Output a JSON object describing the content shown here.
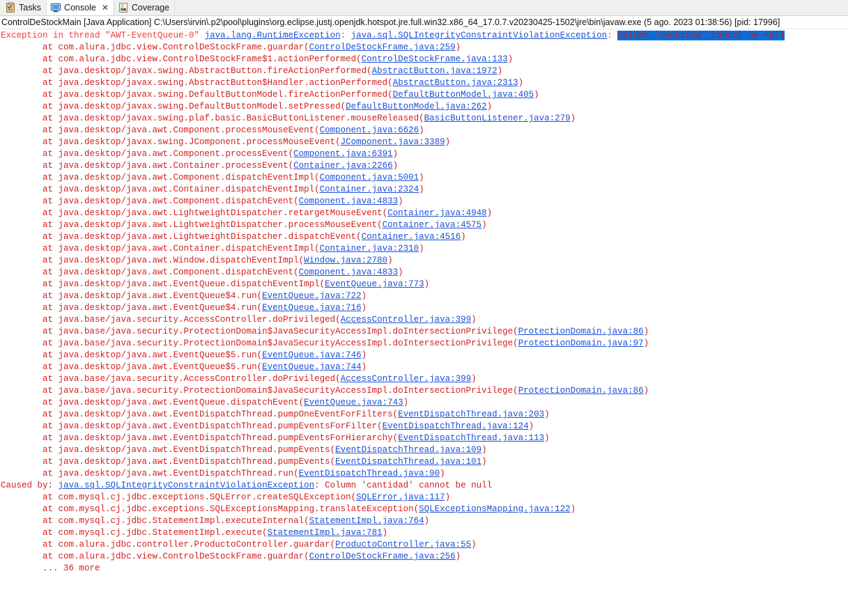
{
  "window": {
    "title": "Eclipse Console"
  },
  "tabs": [
    {
      "label": "Tasks",
      "icon": "tasks-icon",
      "active": false,
      "closable": false
    },
    {
      "label": "Console",
      "icon": "console-icon",
      "active": true,
      "closable": true,
      "close_glyph": "✕"
    },
    {
      "label": "Coverage",
      "icon": "coverage-icon",
      "active": false,
      "closable": false
    }
  ],
  "process_header": "ControlDeStockMain [Java Application] C:\\Users\\irvin\\.p2\\pool\\plugins\\org.eclipse.justj.openjdk.hotspot.jre.full.win32.x86_64_17.0.7.v20230425-1502\\jre\\bin\\javaw.exe  (5 ago. 2023 01:38:56) [pid: 17996]",
  "colors": {
    "error_red": "#ef3e36",
    "stderr_red": "#d32020",
    "hyperlink_blue": "#1a4fd6",
    "selection_blue": "#0a6ed8",
    "tab_bar_bg": "#f0f0f0",
    "console_bg": "#ffffff"
  },
  "selection": {
    "text": "Column 'cantidad' cannot be null"
  },
  "console_lines": [
    {
      "indent": 0,
      "parts": [
        {
          "t": "Exception in thread \"AWT-EventQueue-0\" ",
          "s": "err"
        },
        {
          "t": "java.lang.RuntimeException",
          "s": "link"
        },
        {
          "t": ": ",
          "s": "err"
        },
        {
          "t": "java.sql.SQLIntegrityConstraintViolationException",
          "s": "link"
        },
        {
          "t": ": ",
          "s": "err"
        },
        {
          "t": "Column 'cantidad' cannot be null",
          "s": "sel"
        }
      ]
    },
    {
      "indent": 8,
      "parts": [
        {
          "t": "at com.alura.jdbc.view.ControlDeStockFrame.guardar(",
          "s": "sev"
        },
        {
          "t": "ControlDeStockFrame.java:259",
          "s": "link"
        },
        {
          "t": ")",
          "s": "sev"
        }
      ]
    },
    {
      "indent": 8,
      "parts": [
        {
          "t": "at com.alura.jdbc.view.ControlDeStockFrame$1.actionPerformed(",
          "s": "sev"
        },
        {
          "t": "ControlDeStockFrame.java:133",
          "s": "link"
        },
        {
          "t": ")",
          "s": "sev"
        }
      ]
    },
    {
      "indent": 8,
      "parts": [
        {
          "t": "at java.desktop/javax.swing.AbstractButton.fireActionPerformed(",
          "s": "sev"
        },
        {
          "t": "AbstractButton.java:1972",
          "s": "link"
        },
        {
          "t": ")",
          "s": "sev"
        }
      ]
    },
    {
      "indent": 8,
      "parts": [
        {
          "t": "at java.desktop/javax.swing.AbstractButton$Handler.actionPerformed(",
          "s": "sev"
        },
        {
          "t": "AbstractButton.java:2313",
          "s": "link"
        },
        {
          "t": ")",
          "s": "sev"
        }
      ]
    },
    {
      "indent": 8,
      "parts": [
        {
          "t": "at java.desktop/javax.swing.DefaultButtonModel.fireActionPerformed(",
          "s": "sev"
        },
        {
          "t": "DefaultButtonModel.java:405",
          "s": "link"
        },
        {
          "t": ")",
          "s": "sev"
        }
      ]
    },
    {
      "indent": 8,
      "parts": [
        {
          "t": "at java.desktop/javax.swing.DefaultButtonModel.setPressed(",
          "s": "sev"
        },
        {
          "t": "DefaultButtonModel.java:262",
          "s": "link"
        },
        {
          "t": ")",
          "s": "sev"
        }
      ]
    },
    {
      "indent": 8,
      "parts": [
        {
          "t": "at java.desktop/javax.swing.plaf.basic.BasicButtonListener.mouseReleased(",
          "s": "sev"
        },
        {
          "t": "BasicButtonListener.java:279",
          "s": "link"
        },
        {
          "t": ")",
          "s": "sev"
        }
      ]
    },
    {
      "indent": 8,
      "parts": [
        {
          "t": "at java.desktop/java.awt.Component.processMouseEvent(",
          "s": "sev"
        },
        {
          "t": "Component.java:6626",
          "s": "link"
        },
        {
          "t": ")",
          "s": "sev"
        }
      ]
    },
    {
      "indent": 8,
      "parts": [
        {
          "t": "at java.desktop/javax.swing.JComponent.processMouseEvent(",
          "s": "sev"
        },
        {
          "t": "JComponent.java:3389",
          "s": "link"
        },
        {
          "t": ")",
          "s": "sev"
        }
      ]
    },
    {
      "indent": 8,
      "parts": [
        {
          "t": "at java.desktop/java.awt.Component.processEvent(",
          "s": "sev"
        },
        {
          "t": "Component.java:6391",
          "s": "link"
        },
        {
          "t": ")",
          "s": "sev"
        }
      ]
    },
    {
      "indent": 8,
      "parts": [
        {
          "t": "at java.desktop/java.awt.Container.processEvent(",
          "s": "sev"
        },
        {
          "t": "Container.java:2266",
          "s": "link"
        },
        {
          "t": ")",
          "s": "sev"
        }
      ]
    },
    {
      "indent": 8,
      "parts": [
        {
          "t": "at java.desktop/java.awt.Component.dispatchEventImpl(",
          "s": "sev"
        },
        {
          "t": "Component.java:5001",
          "s": "link"
        },
        {
          "t": ")",
          "s": "sev"
        }
      ]
    },
    {
      "indent": 8,
      "parts": [
        {
          "t": "at java.desktop/java.awt.Container.dispatchEventImpl(",
          "s": "sev"
        },
        {
          "t": "Container.java:2324",
          "s": "link"
        },
        {
          "t": ")",
          "s": "sev"
        }
      ]
    },
    {
      "indent": 8,
      "parts": [
        {
          "t": "at java.desktop/java.awt.Component.dispatchEvent(",
          "s": "sev"
        },
        {
          "t": "Component.java:4833",
          "s": "link"
        },
        {
          "t": ")",
          "s": "sev"
        }
      ]
    },
    {
      "indent": 8,
      "parts": [
        {
          "t": "at java.desktop/java.awt.LightweightDispatcher.retargetMouseEvent(",
          "s": "sev"
        },
        {
          "t": "Container.java:4948",
          "s": "link"
        },
        {
          "t": ")",
          "s": "sev"
        }
      ]
    },
    {
      "indent": 8,
      "parts": [
        {
          "t": "at java.desktop/java.awt.LightweightDispatcher.processMouseEvent(",
          "s": "sev"
        },
        {
          "t": "Container.java:4575",
          "s": "link"
        },
        {
          "t": ")",
          "s": "sev"
        }
      ]
    },
    {
      "indent": 8,
      "parts": [
        {
          "t": "at java.desktop/java.awt.LightweightDispatcher.dispatchEvent(",
          "s": "sev"
        },
        {
          "t": "Container.java:4516",
          "s": "link"
        },
        {
          "t": ")",
          "s": "sev"
        }
      ]
    },
    {
      "indent": 8,
      "parts": [
        {
          "t": "at java.desktop/java.awt.Container.dispatchEventImpl(",
          "s": "sev"
        },
        {
          "t": "Container.java:2310",
          "s": "link"
        },
        {
          "t": ")",
          "s": "sev"
        }
      ]
    },
    {
      "indent": 8,
      "parts": [
        {
          "t": "at java.desktop/java.awt.Window.dispatchEventImpl(",
          "s": "sev"
        },
        {
          "t": "Window.java:2780",
          "s": "link"
        },
        {
          "t": ")",
          "s": "sev"
        }
      ]
    },
    {
      "indent": 8,
      "parts": [
        {
          "t": "at java.desktop/java.awt.Component.dispatchEvent(",
          "s": "sev"
        },
        {
          "t": "Component.java:4833",
          "s": "link"
        },
        {
          "t": ")",
          "s": "sev"
        }
      ]
    },
    {
      "indent": 8,
      "parts": [
        {
          "t": "at java.desktop/java.awt.EventQueue.dispatchEventImpl(",
          "s": "sev"
        },
        {
          "t": "EventQueue.java:773",
          "s": "link"
        },
        {
          "t": ")",
          "s": "sev"
        }
      ]
    },
    {
      "indent": 8,
      "parts": [
        {
          "t": "at java.desktop/java.awt.EventQueue$4.run(",
          "s": "sev"
        },
        {
          "t": "EventQueue.java:722",
          "s": "link"
        },
        {
          "t": ")",
          "s": "sev"
        }
      ]
    },
    {
      "indent": 8,
      "parts": [
        {
          "t": "at java.desktop/java.awt.EventQueue$4.run(",
          "s": "sev"
        },
        {
          "t": "EventQueue.java:716",
          "s": "link"
        },
        {
          "t": ")",
          "s": "sev"
        }
      ]
    },
    {
      "indent": 8,
      "parts": [
        {
          "t": "at java.base/java.security.AccessController.doPrivileged(",
          "s": "sev"
        },
        {
          "t": "AccessController.java:399",
          "s": "link"
        },
        {
          "t": ")",
          "s": "sev"
        }
      ]
    },
    {
      "indent": 8,
      "parts": [
        {
          "t": "at java.base/java.security.ProtectionDomain$JavaSecurityAccessImpl.doIntersectionPrivilege(",
          "s": "sev"
        },
        {
          "t": "ProtectionDomain.java:86",
          "s": "link"
        },
        {
          "t": ")",
          "s": "sev"
        }
      ]
    },
    {
      "indent": 8,
      "parts": [
        {
          "t": "at java.base/java.security.ProtectionDomain$JavaSecurityAccessImpl.doIntersectionPrivilege(",
          "s": "sev"
        },
        {
          "t": "ProtectionDomain.java:97",
          "s": "link"
        },
        {
          "t": ")",
          "s": "sev"
        }
      ]
    },
    {
      "indent": 8,
      "parts": [
        {
          "t": "at java.desktop/java.awt.EventQueue$5.run(",
          "s": "sev"
        },
        {
          "t": "EventQueue.java:746",
          "s": "link"
        },
        {
          "t": ")",
          "s": "sev"
        }
      ]
    },
    {
      "indent": 8,
      "parts": [
        {
          "t": "at java.desktop/java.awt.EventQueue$5.run(",
          "s": "sev"
        },
        {
          "t": "EventQueue.java:744",
          "s": "link"
        },
        {
          "t": ")",
          "s": "sev"
        }
      ]
    },
    {
      "indent": 8,
      "parts": [
        {
          "t": "at java.base/java.security.AccessController.doPrivileged(",
          "s": "sev"
        },
        {
          "t": "AccessController.java:399",
          "s": "link"
        },
        {
          "t": ")",
          "s": "sev"
        }
      ]
    },
    {
      "indent": 8,
      "parts": [
        {
          "t": "at java.base/java.security.ProtectionDomain$JavaSecurityAccessImpl.doIntersectionPrivilege(",
          "s": "sev"
        },
        {
          "t": "ProtectionDomain.java:86",
          "s": "link"
        },
        {
          "t": ")",
          "s": "sev"
        }
      ]
    },
    {
      "indent": 8,
      "parts": [
        {
          "t": "at java.desktop/java.awt.EventQueue.dispatchEvent(",
          "s": "sev"
        },
        {
          "t": "EventQueue.java:743",
          "s": "link"
        },
        {
          "t": ")",
          "s": "sev"
        }
      ]
    },
    {
      "indent": 8,
      "parts": [
        {
          "t": "at java.desktop/java.awt.EventDispatchThread.pumpOneEventForFilters(",
          "s": "sev"
        },
        {
          "t": "EventDispatchThread.java:203",
          "s": "link"
        },
        {
          "t": ")",
          "s": "sev"
        }
      ]
    },
    {
      "indent": 8,
      "parts": [
        {
          "t": "at java.desktop/java.awt.EventDispatchThread.pumpEventsForFilter(",
          "s": "sev"
        },
        {
          "t": "EventDispatchThread.java:124",
          "s": "link"
        },
        {
          "t": ")",
          "s": "sev"
        }
      ]
    },
    {
      "indent": 8,
      "parts": [
        {
          "t": "at java.desktop/java.awt.EventDispatchThread.pumpEventsForHierarchy(",
          "s": "sev"
        },
        {
          "t": "EventDispatchThread.java:113",
          "s": "link"
        },
        {
          "t": ")",
          "s": "sev"
        }
      ]
    },
    {
      "indent": 8,
      "parts": [
        {
          "t": "at java.desktop/java.awt.EventDispatchThread.pumpEvents(",
          "s": "sev"
        },
        {
          "t": "EventDispatchThread.java:109",
          "s": "link"
        },
        {
          "t": ")",
          "s": "sev"
        }
      ]
    },
    {
      "indent": 8,
      "parts": [
        {
          "t": "at java.desktop/java.awt.EventDispatchThread.pumpEvents(",
          "s": "sev"
        },
        {
          "t": "EventDispatchThread.java:101",
          "s": "link"
        },
        {
          "t": ")",
          "s": "sev"
        }
      ]
    },
    {
      "indent": 8,
      "parts": [
        {
          "t": "at java.desktop/java.awt.EventDispatchThread.run(",
          "s": "sev"
        },
        {
          "t": "EventDispatchThread.java:90",
          "s": "link"
        },
        {
          "t": ")",
          "s": "sev"
        }
      ]
    },
    {
      "indent": 0,
      "parts": [
        {
          "t": "Caused by: ",
          "s": "sev"
        },
        {
          "t": "java.sql.SQLIntegrityConstraintViolationException",
          "s": "link"
        },
        {
          "t": ": Column 'cantidad' cannot be null",
          "s": "sev"
        }
      ]
    },
    {
      "indent": 8,
      "parts": [
        {
          "t": "at com.mysql.cj.jdbc.exceptions.SQLError.createSQLException(",
          "s": "sev"
        },
        {
          "t": "SQLError.java:117",
          "s": "link"
        },
        {
          "t": ")",
          "s": "sev"
        }
      ]
    },
    {
      "indent": 8,
      "parts": [
        {
          "t": "at com.mysql.cj.jdbc.exceptions.SQLExceptionsMapping.translateException(",
          "s": "sev"
        },
        {
          "t": "SQLExceptionsMapping.java:122",
          "s": "link"
        },
        {
          "t": ")",
          "s": "sev"
        }
      ]
    },
    {
      "indent": 8,
      "parts": [
        {
          "t": "at com.mysql.cj.jdbc.StatementImpl.executeInternal(",
          "s": "sev"
        },
        {
          "t": "StatementImpl.java:764",
          "s": "link"
        },
        {
          "t": ")",
          "s": "sev"
        }
      ]
    },
    {
      "indent": 8,
      "parts": [
        {
          "t": "at com.mysql.cj.jdbc.StatementImpl.execute(",
          "s": "sev"
        },
        {
          "t": "StatementImpl.java:781",
          "s": "link"
        },
        {
          "t": ")",
          "s": "sev"
        }
      ]
    },
    {
      "indent": 8,
      "parts": [
        {
          "t": "at com.alura.jdbc.controller.ProductoController.guardar(",
          "s": "sev"
        },
        {
          "t": "ProductoController.java:55",
          "s": "link"
        },
        {
          "t": ")",
          "s": "sev"
        }
      ]
    },
    {
      "indent": 8,
      "parts": [
        {
          "t": "at com.alura.jdbc.view.ControlDeStockFrame.guardar(",
          "s": "sev"
        },
        {
          "t": "ControlDeStockFrame.java:256",
          "s": "link"
        },
        {
          "t": ")",
          "s": "sev"
        }
      ]
    },
    {
      "indent": 8,
      "parts": [
        {
          "t": "... 36 more",
          "s": "sev"
        }
      ]
    }
  ]
}
